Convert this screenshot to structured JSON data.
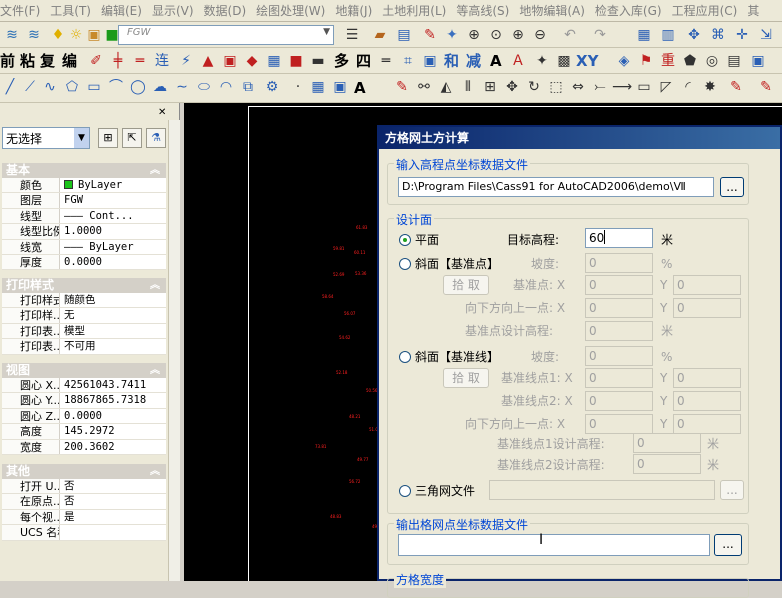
{
  "menubar": {
    "items": [
      "文件(F)",
      "工具(T)",
      "编辑(E)",
      "显示(V)",
      "数据(D)",
      "绘图处理(W)",
      "地籍(J)",
      "土地利用(L)",
      "等高线(S)",
      "地物编辑(A)",
      "检查入库(G)",
      "工程应用(C)",
      "其"
    ]
  },
  "toolbar": {
    "layer_combo": "FGW",
    "text_tools": [
      "前",
      "粘",
      "复",
      "编",
      "多",
      "四",
      "和",
      "减",
      "A",
      "XY"
    ]
  },
  "palette": {
    "selection": "无选择",
    "sections": {
      "basic": {
        "title": "基本",
        "rows": [
          {
            "key": "颜色",
            "value": "ByLayer"
          },
          {
            "key": "图层",
            "value": "FGW"
          },
          {
            "key": "线型",
            "value": "——— Cont..."
          },
          {
            "key": "线型比例",
            "value": "1.0000"
          },
          {
            "key": "线宽",
            "value": "——— ByLayer"
          },
          {
            "key": "厚度",
            "value": "0.0000"
          }
        ]
      },
      "print": {
        "title": "打印样式",
        "rows": [
          {
            "key": "打印样式",
            "value": "随颜色"
          },
          {
            "key": "打印样...",
            "value": "无"
          },
          {
            "key": "打印表...",
            "value": "模型"
          },
          {
            "key": "打印表...",
            "value": "不可用"
          }
        ]
      },
      "view": {
        "title": "视图",
        "rows": [
          {
            "key": "圆心 X...",
            "value": "42561043.7411"
          },
          {
            "key": "圆心 Y...",
            "value": "18867865.7318"
          },
          {
            "key": "圆心 Z...",
            "value": "0.0000"
          },
          {
            "key": "高度",
            "value": "145.2972"
          },
          {
            "key": "宽度",
            "value": "200.3602"
          }
        ]
      },
      "misc": {
        "title": "其他",
        "rows": [
          {
            "key": "打开 U...",
            "value": "否"
          },
          {
            "key": "在原点...",
            "value": "否"
          },
          {
            "key": "每个视...",
            "value": "是"
          },
          {
            "key": "UCS 名称",
            "value": ""
          }
        ]
      }
    }
  },
  "dialog": {
    "title": "方格网土方计算",
    "input_group_title": "输入高程点坐标数据文件",
    "input_path": "D:\\Program Files\\Cass91 for AutoCAD2006\\demo\\Ⅶ",
    "browse_label": "...",
    "design_group_title": "设计面",
    "plane": {
      "label": "平面",
      "target_label": "目标高程:",
      "target_value": "60",
      "unit": "米"
    },
    "slope_point": {
      "label": "斜面【基准点】",
      "slope_label": "坡度:",
      "slope_value": "0",
      "slope_unit": "%",
      "pick_label": "拾 取",
      "base_label": "基准点: X",
      "base_x": "0",
      "y_label": "Y",
      "base_y": "0",
      "down_label": "向下方向上一点: X",
      "down_x": "0",
      "down_y": "0",
      "elev_label": "基准点设计高程:",
      "elev_value": "0",
      "elev_unit": "米"
    },
    "slope_line": {
      "label": "斜面【基准线】",
      "slope_label": "坡度:",
      "slope_value": "0",
      "slope_unit": "%",
      "pick_label": "拾 取",
      "p1_label": "基准线点1: X",
      "p1_x": "0",
      "p1_y": "0",
      "p2_label": "基准线点2: X",
      "p2_x": "0",
      "p2_y": "0",
      "down_label": "向下方向上一点: X",
      "down_x": "0",
      "down_y": "0",
      "e1_label": "基准线点1设计高程:",
      "e1_value": "0",
      "e2_label": "基准线点2设计高程:",
      "e2_value": "0",
      "unit": "米"
    },
    "tin": {
      "label": "三角网文件"
    },
    "output_group_title": "输出格网点坐标数据文件",
    "grid_width_title": "方格宽度"
  },
  "drawing": {
    "points": [
      "61.83",
      "59.81",
      "60.11",
      "52.69",
      "53.36",
      "58.64",
      "56.07",
      "54.62",
      "52.18",
      "50.56",
      "55.53",
      "48.21",
      "51.09",
      "73.81",
      "49.77",
      "56.72",
      "48.83",
      "49.21"
    ]
  },
  "colors": {
    "title_bar": "#0a246a",
    "group_title": "#0046d5",
    "point_text": "#ff2020"
  }
}
